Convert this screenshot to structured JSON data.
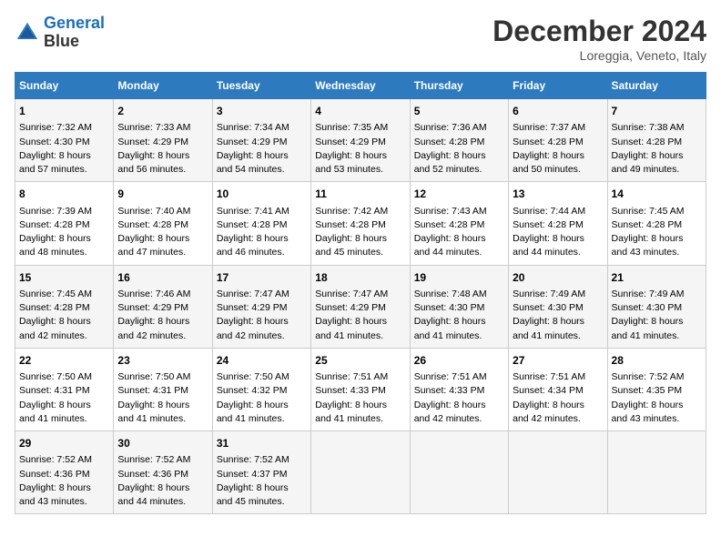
{
  "header": {
    "logo_line1": "General",
    "logo_line2": "Blue",
    "month_year": "December 2024",
    "location": "Loreggia, Veneto, Italy"
  },
  "columns": [
    "Sunday",
    "Monday",
    "Tuesday",
    "Wednesday",
    "Thursday",
    "Friday",
    "Saturday"
  ],
  "weeks": [
    [
      {
        "day": "1",
        "lines": [
          "Sunrise: 7:32 AM",
          "Sunset: 4:30 PM",
          "Daylight: 8 hours",
          "and 57 minutes."
        ]
      },
      {
        "day": "2",
        "lines": [
          "Sunrise: 7:33 AM",
          "Sunset: 4:29 PM",
          "Daylight: 8 hours",
          "and 56 minutes."
        ]
      },
      {
        "day": "3",
        "lines": [
          "Sunrise: 7:34 AM",
          "Sunset: 4:29 PM",
          "Daylight: 8 hours",
          "and 54 minutes."
        ]
      },
      {
        "day": "4",
        "lines": [
          "Sunrise: 7:35 AM",
          "Sunset: 4:29 PM",
          "Daylight: 8 hours",
          "and 53 minutes."
        ]
      },
      {
        "day": "5",
        "lines": [
          "Sunrise: 7:36 AM",
          "Sunset: 4:28 PM",
          "Daylight: 8 hours",
          "and 52 minutes."
        ]
      },
      {
        "day": "6",
        "lines": [
          "Sunrise: 7:37 AM",
          "Sunset: 4:28 PM",
          "Daylight: 8 hours",
          "and 50 minutes."
        ]
      },
      {
        "day": "7",
        "lines": [
          "Sunrise: 7:38 AM",
          "Sunset: 4:28 PM",
          "Daylight: 8 hours",
          "and 49 minutes."
        ]
      }
    ],
    [
      {
        "day": "8",
        "lines": [
          "Sunrise: 7:39 AM",
          "Sunset: 4:28 PM",
          "Daylight: 8 hours",
          "and 48 minutes."
        ]
      },
      {
        "day": "9",
        "lines": [
          "Sunrise: 7:40 AM",
          "Sunset: 4:28 PM",
          "Daylight: 8 hours",
          "and 47 minutes."
        ]
      },
      {
        "day": "10",
        "lines": [
          "Sunrise: 7:41 AM",
          "Sunset: 4:28 PM",
          "Daylight: 8 hours",
          "and 46 minutes."
        ]
      },
      {
        "day": "11",
        "lines": [
          "Sunrise: 7:42 AM",
          "Sunset: 4:28 PM",
          "Daylight: 8 hours",
          "and 45 minutes."
        ]
      },
      {
        "day": "12",
        "lines": [
          "Sunrise: 7:43 AM",
          "Sunset: 4:28 PM",
          "Daylight: 8 hours",
          "and 44 minutes."
        ]
      },
      {
        "day": "13",
        "lines": [
          "Sunrise: 7:44 AM",
          "Sunset: 4:28 PM",
          "Daylight: 8 hours",
          "and 44 minutes."
        ]
      },
      {
        "day": "14",
        "lines": [
          "Sunrise: 7:45 AM",
          "Sunset: 4:28 PM",
          "Daylight: 8 hours",
          "and 43 minutes."
        ]
      }
    ],
    [
      {
        "day": "15",
        "lines": [
          "Sunrise: 7:45 AM",
          "Sunset: 4:28 PM",
          "Daylight: 8 hours",
          "and 42 minutes."
        ]
      },
      {
        "day": "16",
        "lines": [
          "Sunrise: 7:46 AM",
          "Sunset: 4:29 PM",
          "Daylight: 8 hours",
          "and 42 minutes."
        ]
      },
      {
        "day": "17",
        "lines": [
          "Sunrise: 7:47 AM",
          "Sunset: 4:29 PM",
          "Daylight: 8 hours",
          "and 42 minutes."
        ]
      },
      {
        "day": "18",
        "lines": [
          "Sunrise: 7:47 AM",
          "Sunset: 4:29 PM",
          "Daylight: 8 hours",
          "and 41 minutes."
        ]
      },
      {
        "day": "19",
        "lines": [
          "Sunrise: 7:48 AM",
          "Sunset: 4:30 PM",
          "Daylight: 8 hours",
          "and 41 minutes."
        ]
      },
      {
        "day": "20",
        "lines": [
          "Sunrise: 7:49 AM",
          "Sunset: 4:30 PM",
          "Daylight: 8 hours",
          "and 41 minutes."
        ]
      },
      {
        "day": "21",
        "lines": [
          "Sunrise: 7:49 AM",
          "Sunset: 4:30 PM",
          "Daylight: 8 hours",
          "and 41 minutes."
        ]
      }
    ],
    [
      {
        "day": "22",
        "lines": [
          "Sunrise: 7:50 AM",
          "Sunset: 4:31 PM",
          "Daylight: 8 hours",
          "and 41 minutes."
        ]
      },
      {
        "day": "23",
        "lines": [
          "Sunrise: 7:50 AM",
          "Sunset: 4:31 PM",
          "Daylight: 8 hours",
          "and 41 minutes."
        ]
      },
      {
        "day": "24",
        "lines": [
          "Sunrise: 7:50 AM",
          "Sunset: 4:32 PM",
          "Daylight: 8 hours",
          "and 41 minutes."
        ]
      },
      {
        "day": "25",
        "lines": [
          "Sunrise: 7:51 AM",
          "Sunset: 4:33 PM",
          "Daylight: 8 hours",
          "and 41 minutes."
        ]
      },
      {
        "day": "26",
        "lines": [
          "Sunrise: 7:51 AM",
          "Sunset: 4:33 PM",
          "Daylight: 8 hours",
          "and 42 minutes."
        ]
      },
      {
        "day": "27",
        "lines": [
          "Sunrise: 7:51 AM",
          "Sunset: 4:34 PM",
          "Daylight: 8 hours",
          "and 42 minutes."
        ]
      },
      {
        "day": "28",
        "lines": [
          "Sunrise: 7:52 AM",
          "Sunset: 4:35 PM",
          "Daylight: 8 hours",
          "and 43 minutes."
        ]
      }
    ],
    [
      {
        "day": "29",
        "lines": [
          "Sunrise: 7:52 AM",
          "Sunset: 4:36 PM",
          "Daylight: 8 hours",
          "and 43 minutes."
        ]
      },
      {
        "day": "30",
        "lines": [
          "Sunrise: 7:52 AM",
          "Sunset: 4:36 PM",
          "Daylight: 8 hours",
          "and 44 minutes."
        ]
      },
      {
        "day": "31",
        "lines": [
          "Sunrise: 7:52 AM",
          "Sunset: 4:37 PM",
          "Daylight: 8 hours",
          "and 45 minutes."
        ]
      },
      null,
      null,
      null,
      null
    ]
  ]
}
